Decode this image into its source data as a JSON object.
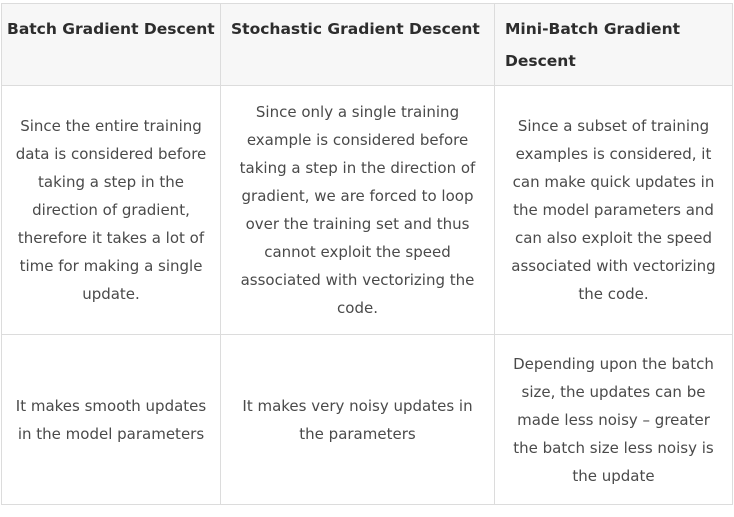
{
  "table": {
    "headers": [
      "Batch Gradient Descent",
      "Stochastic Gradient Descent",
      "Mini-Batch Gradient Descent"
    ],
    "rows": [
      [
        "Since the entire training data is considered before taking a step in the direction of gradient, therefore it takes a lot of time for making a single update.",
        "Since only a single training example is considered before taking a step in the direction of gradient, we are forced to loop over the training set and thus cannot exploit the speed associated with vectorizing the code.",
        "Since a subset of training examples is considered, it can make quick updates in the model parameters and can also exploit the speed associated with vectorizing the code."
      ],
      [
        "It makes smooth updates in the model parameters",
        "It makes very noisy updates in the parameters",
        "Depending upon the batch size, the updates can be made less noisy – greater the batch size less noisy is the update"
      ]
    ]
  }
}
